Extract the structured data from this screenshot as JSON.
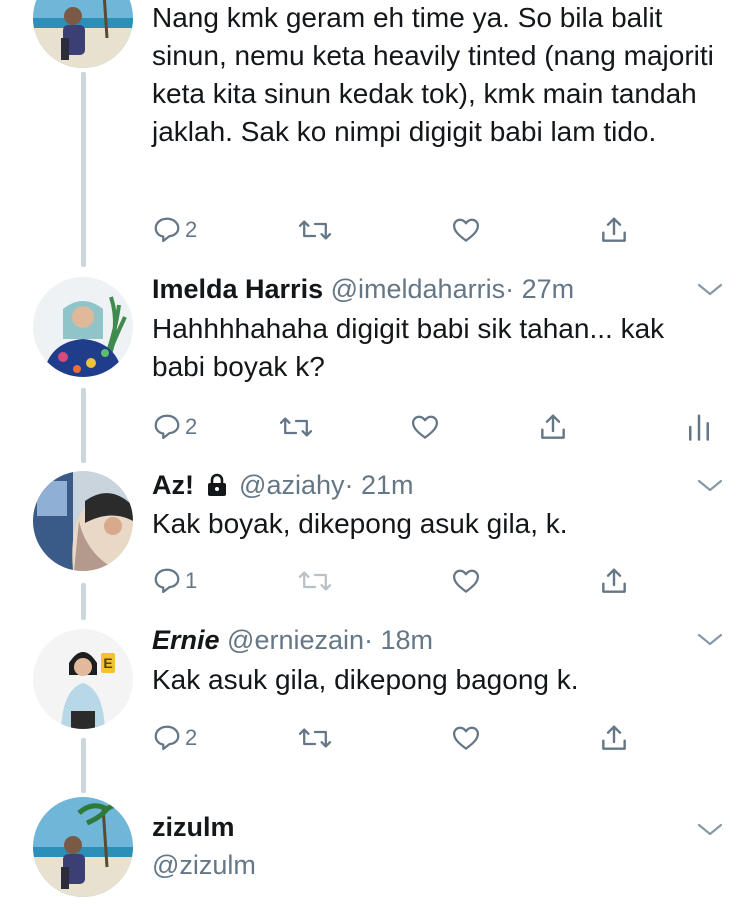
{
  "tweets": [
    {
      "text": "Nang kmk geram eh time ya. So bila balit sinun, nemu keta heavily tinted (nang majoriti keta kita sinun kedak tok), kmk main tandah jaklah. Sak ko nimpi digigit babi lam tido.",
      "replies": "2"
    },
    {
      "name": "Imelda Harris",
      "handle": "@imeldaharris",
      "time": "· 27m",
      "text": "Hahhhhahaha digigit babi sik tahan... kak babi boyak k?",
      "replies": "2"
    },
    {
      "name": "Az!",
      "handle": "@aziahy",
      "time": "· 21m",
      "text": "Kak boyak, dikepong asuk gila, k.",
      "replies": "1"
    },
    {
      "name": "Ernie",
      "handle": "@erniezain",
      "time": "· 18m",
      "text": "Kak asuk gila, dikepong bagong k.",
      "replies": "2"
    },
    {
      "name": "zizulm",
      "handle": "@zizulm"
    }
  ],
  "colors": {
    "text": "#14171a",
    "secondary": "#657786",
    "thread_line": "#ccd6dd"
  }
}
